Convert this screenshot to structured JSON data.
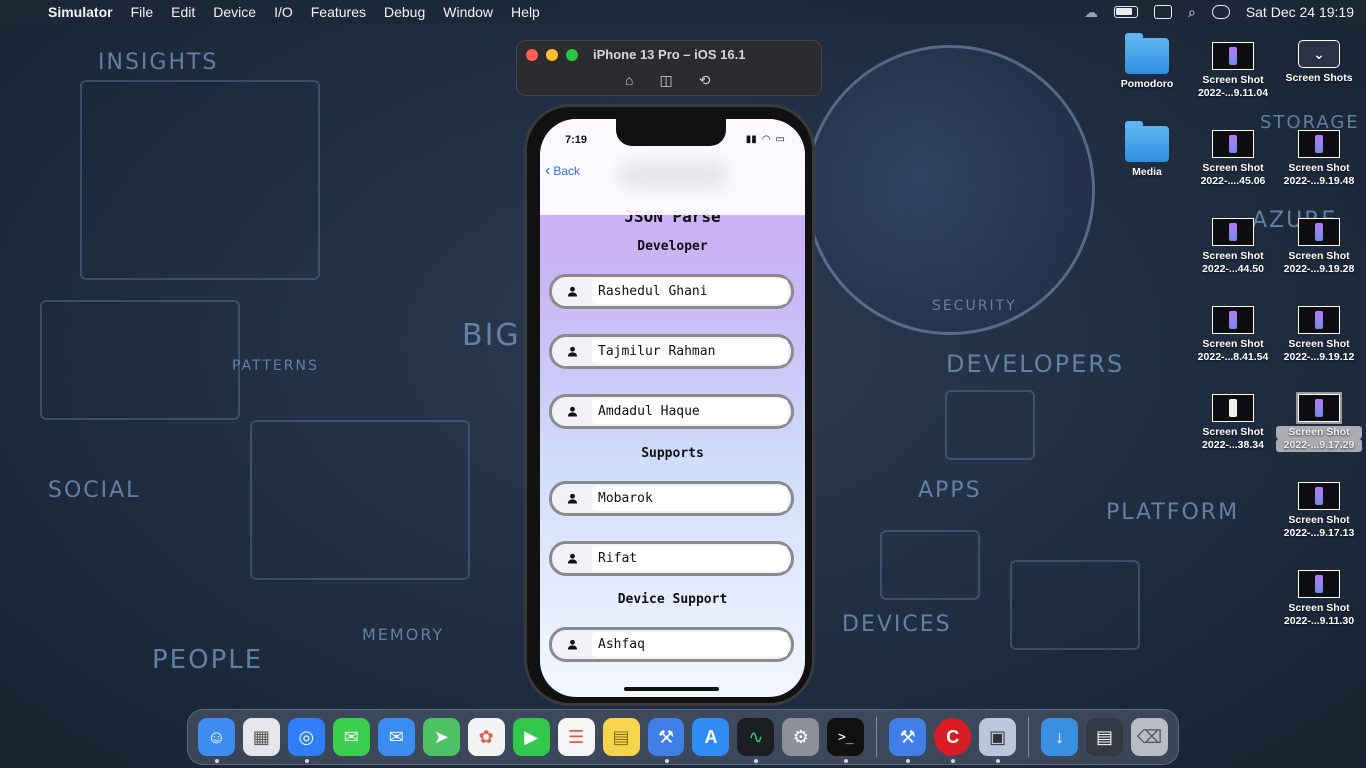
{
  "menubar": {
    "apple_icon": "apple-logo",
    "app_name": "Simulator",
    "items": [
      "File",
      "Edit",
      "Device",
      "I/O",
      "Features",
      "Debug",
      "Window",
      "Help"
    ],
    "clock": "Sat Dec 24  19:19"
  },
  "simulator": {
    "title": "iPhone 13 Pro – iOS 16.1",
    "tools": [
      "home-icon",
      "screenshot-icon",
      "rotate-icon"
    ]
  },
  "phone": {
    "time": "7:19",
    "back_label": "Back",
    "page_title": "JSON Parse",
    "sections": [
      {
        "title": "Developer",
        "people": [
          "Rashedul Ghani",
          "Tajmilur Rahman",
          "Amdadul Haque"
        ]
      },
      {
        "title": "Supports",
        "people": [
          "Mobarok",
          "Rifat"
        ]
      },
      {
        "title": "Device Support",
        "people": [
          "Ashfaq"
        ]
      }
    ]
  },
  "desktop": {
    "icons": [
      {
        "label": "Pomodoro",
        "sub": "",
        "kind": "folder"
      },
      {
        "label": "Screen Shot",
        "sub": "2022-...9.11.04",
        "kind": "thumb"
      },
      {
        "label": "Screen Shots",
        "sub": "",
        "kind": "stack"
      },
      {
        "label": "Media",
        "sub": "",
        "kind": "folder"
      },
      {
        "label": "Screen Shot",
        "sub": "2022-....45.06",
        "kind": "thumb"
      },
      {
        "label": "Screen Shot",
        "sub": "2022-...9.19.48",
        "kind": "thumb"
      },
      {
        "label": "Screen Shot",
        "sub": "2022-...44.50",
        "kind": "thumb"
      },
      {
        "label": "Screen Shot",
        "sub": "2022-...9.19.28",
        "kind": "thumb"
      },
      {
        "label": "Screen Shot",
        "sub": "2022-...8.41.54",
        "kind": "thumb"
      },
      {
        "label": "Screen Shot",
        "sub": "2022-...9.19.12",
        "kind": "thumb"
      },
      {
        "label": "Screen Shot",
        "sub": "2022-...38.34",
        "kind": "thumb"
      },
      {
        "label": "Screen Shot",
        "sub": "2022-...9.17.29",
        "kind": "thumb"
      },
      {
        "label": "Screen Shot",
        "sub": "2022-...9.17.13",
        "kind": "thumb"
      },
      {
        "label": "Screen Shot",
        "sub": "2022-...9.11.30",
        "kind": "thumb"
      }
    ]
  },
  "wallpaper_words": [
    "INSIGHTS",
    "SOCIAL",
    "PEOPLE",
    "PATTERNS",
    "MEMORY",
    "BIG D",
    "SECURITY",
    "DEVELOPERS",
    "APPS",
    "PLATFORM",
    "DEVICES",
    "STORAGE",
    "AZURE"
  ],
  "dock": {
    "apps": [
      {
        "name": "finder-icon",
        "color": "#3d8ef0",
        "glyph": "☺"
      },
      {
        "name": "launchpad-icon",
        "color": "#e6e6ea",
        "glyph": "▦"
      },
      {
        "name": "safari-icon",
        "color": "#2f7ef5",
        "glyph": "◎"
      },
      {
        "name": "messages-icon",
        "color": "#3ccf4e",
        "glyph": "✉"
      },
      {
        "name": "mail-icon",
        "color": "#3a8cf0",
        "glyph": "✉"
      },
      {
        "name": "maps-icon",
        "color": "#4fc268",
        "glyph": "➤"
      },
      {
        "name": "photos-icon",
        "color": "#f4f4f4",
        "glyph": "✿"
      },
      {
        "name": "facetime-icon",
        "color": "#33c74d",
        "glyph": "▶"
      },
      {
        "name": "reminders-icon",
        "color": "#f5f5f5",
        "glyph": "☰"
      },
      {
        "name": "notes-icon",
        "color": "#f7d54a",
        "glyph": "▤"
      },
      {
        "name": "xcode-icon",
        "color": "#3f7fe6",
        "glyph": "⚒"
      },
      {
        "name": "app-store-icon",
        "color": "#2f8cf4",
        "glyph": "A"
      },
      {
        "name": "activity-monitor-icon",
        "color": "#1b1f23",
        "glyph": "∿"
      },
      {
        "name": "system-settings-icon",
        "color": "#8c9099",
        "glyph": "⚙"
      },
      {
        "name": "terminal-icon",
        "color": "#111111",
        "glyph": ">_"
      },
      {
        "name": "simulator-xcode-icon",
        "color": "#3f7fe6",
        "glyph": "⚒"
      },
      {
        "name": "red-app-icon",
        "color": "#d91d22",
        "glyph": "C"
      },
      {
        "name": "preview-icon",
        "color": "#b9c7dc",
        "glyph": "▣"
      },
      {
        "name": "downloads-icon",
        "color": "#3a8fe0",
        "glyph": "↓"
      },
      {
        "name": "stack-icon",
        "color": "#333a44",
        "glyph": "▤"
      },
      {
        "name": "trash-icon",
        "color": "#b8bcc4",
        "glyph": "🗑"
      }
    ]
  }
}
